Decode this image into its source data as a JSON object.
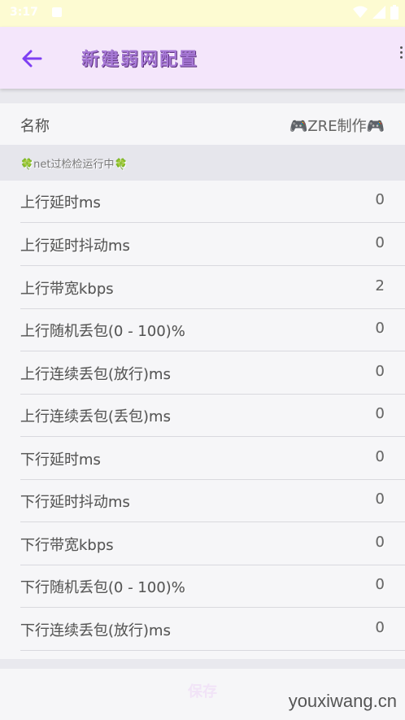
{
  "status_bar": {
    "time": "3:17"
  },
  "app_bar": {
    "title": "新建弱网配置"
  },
  "name_row": {
    "label": "名称",
    "value": "🎮ZRE制作🎮"
  },
  "section": {
    "header": "🍀net过检检运行中🍀"
  },
  "items": [
    {
      "label": "上行延时ms",
      "value": "0"
    },
    {
      "label": "上行延时抖动ms",
      "value": "0"
    },
    {
      "label": "上行带宽kbps",
      "value": "2"
    },
    {
      "label": "上行随机丢包(0 - 100)%",
      "value": "0"
    },
    {
      "label": "上行连续丢包(放行)ms",
      "value": "0"
    },
    {
      "label": "上行连续丢包(丢包)ms",
      "value": "0"
    },
    {
      "label": "下行延时ms",
      "value": "0"
    },
    {
      "label": "下行延时抖动ms",
      "value": "0"
    },
    {
      "label": "下行带宽kbps",
      "value": "0"
    },
    {
      "label": "下行随机丢包(0 - 100)%",
      "value": "0"
    },
    {
      "label": "下行连续丢包(放行)ms",
      "value": "0"
    }
  ],
  "save_label": "保存",
  "watermark": "youxiwang.cn",
  "colors": {
    "app_bar_bg": "#f4e6fb",
    "accent": "#7e3ff2",
    "status_bar_bg": "#fdfbd2"
  }
}
